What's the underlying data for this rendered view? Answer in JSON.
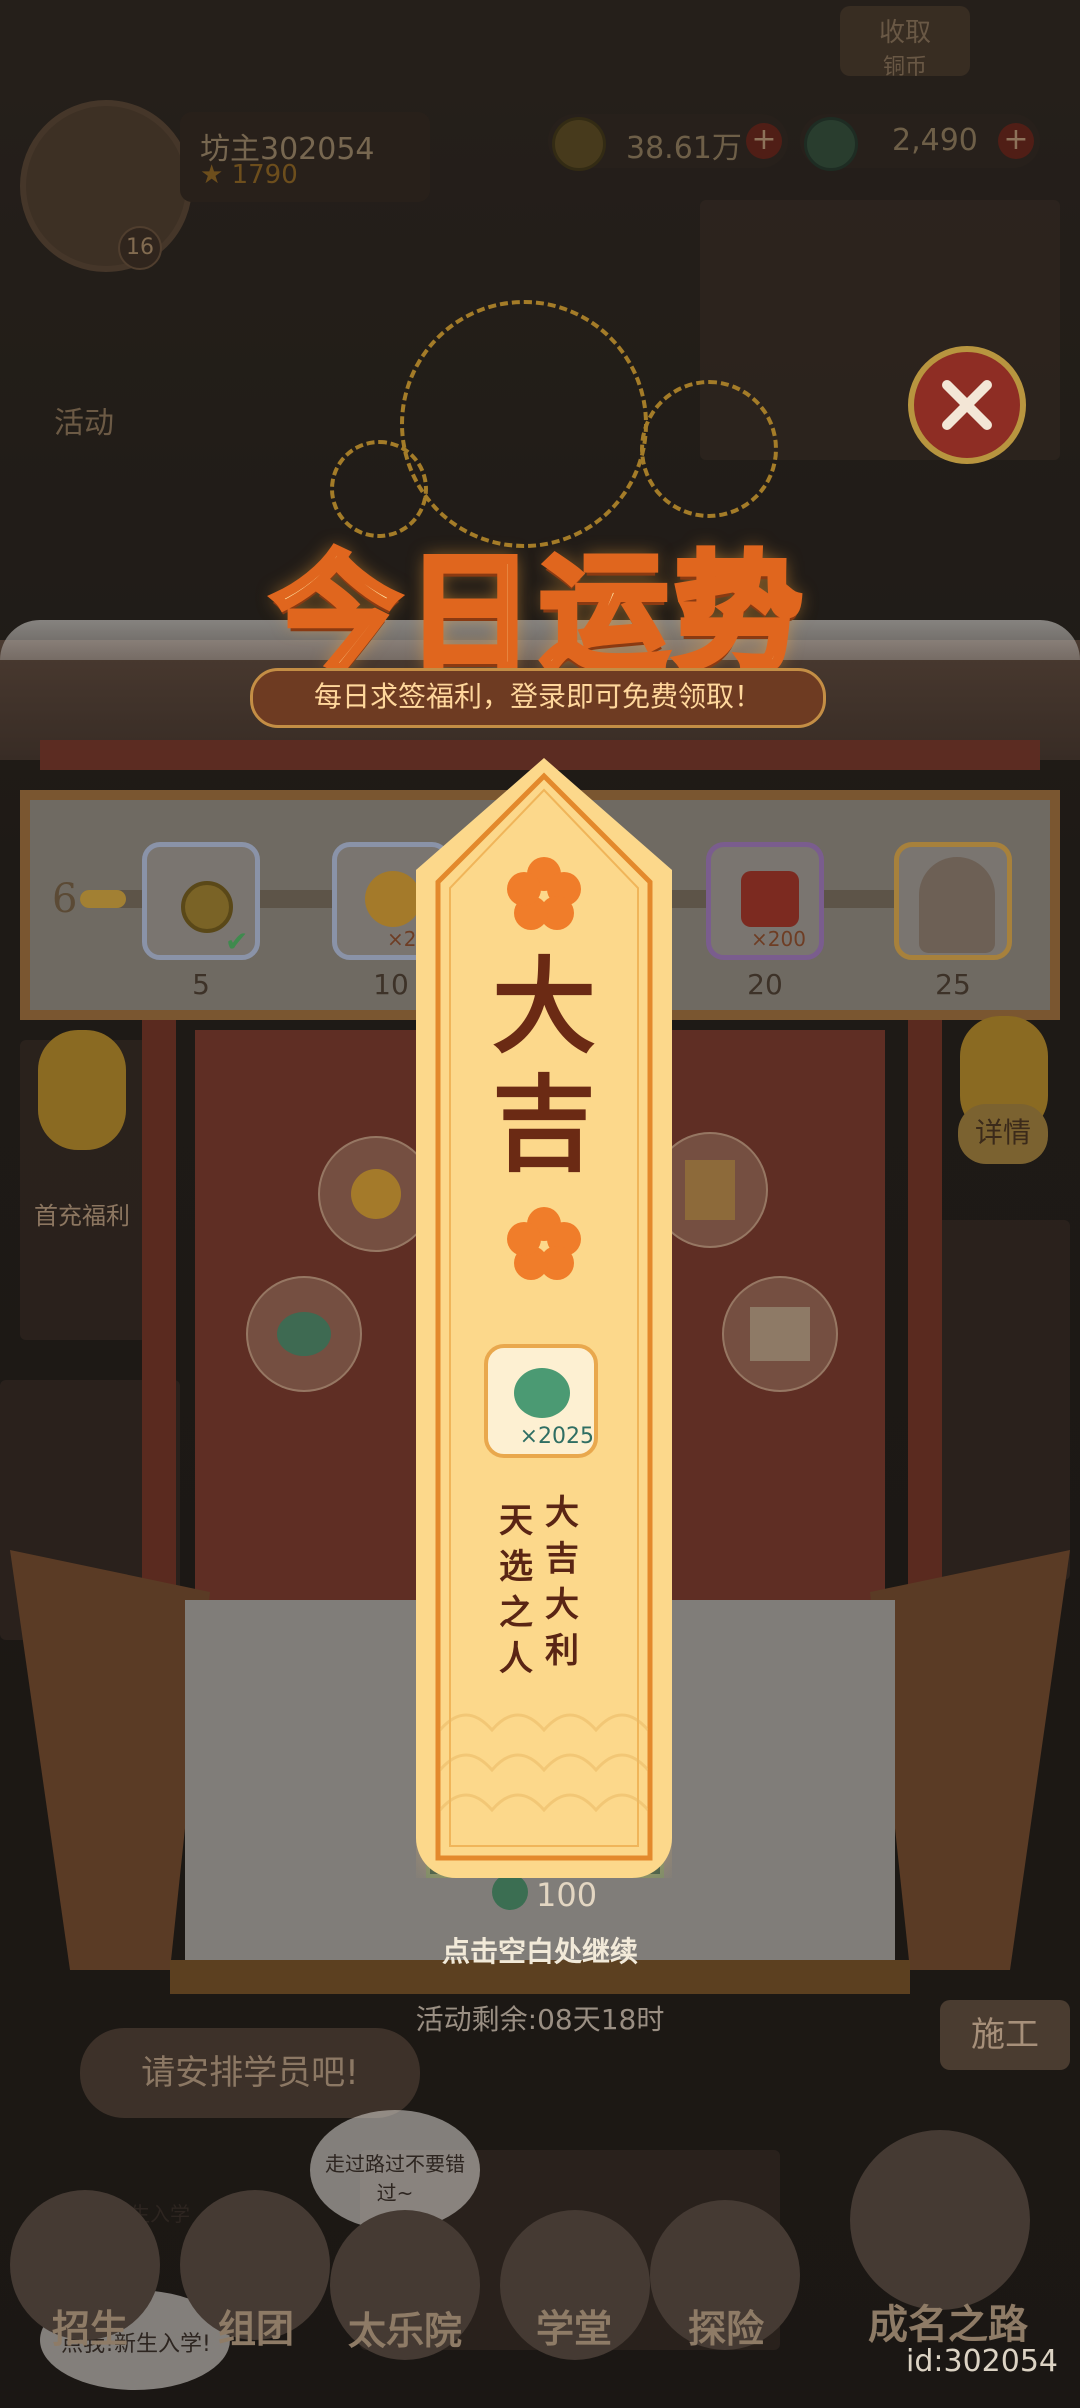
{
  "hud": {
    "player_name": "坊主302054",
    "player_score": "1790",
    "level": "16",
    "coins": "38.61万",
    "jade": "2,490",
    "collect_label": "收取",
    "collect_sub": "铜币",
    "activity_label": "活动"
  },
  "popup": {
    "title": "今日运势",
    "subtitle": "每日求签福利，登录即可免费领取！",
    "progress_start": "6",
    "progress_fraction": 0.05,
    "rewards": [
      {
        "threshold": "5",
        "count": "",
        "icon": "coin-icon",
        "claimed": true
      },
      {
        "threshold": "10",
        "count": "×20",
        "icon": "plum-flower-icon",
        "claimed": false
      },
      {
        "threshold": "20",
        "count": "×200",
        "icon": "red-box-icon",
        "claimed": false
      },
      {
        "threshold": "25",
        "count": "",
        "icon": "character-portrait-icon",
        "claimed": false
      }
    ],
    "details_label": "详情",
    "fortune": "大吉",
    "reward_count": "×2025",
    "verse_right": "大吉大利",
    "verse_left": "天选之人",
    "price": "100",
    "continue_hint": "点击空白处继续",
    "time_remaining": "活动剩余:08天18时",
    "left_label": "首充福利"
  },
  "bottom": {
    "arrange_hint": "请安排学员吧!",
    "construct_label": "施工",
    "nav": [
      "招生",
      "组团",
      "太乐院",
      "学堂",
      "探险",
      "成名之路"
    ],
    "bubble1": "走过路过不要错过~",
    "bubble2": "点我!新生入学!",
    "bubble3": "新生入学",
    "id_label": "id:302054"
  },
  "colors": {
    "accent": "#e0661e",
    "stick": "#fcd88b",
    "fortune_text": "#6b2a14",
    "close": "#8e2d24"
  }
}
